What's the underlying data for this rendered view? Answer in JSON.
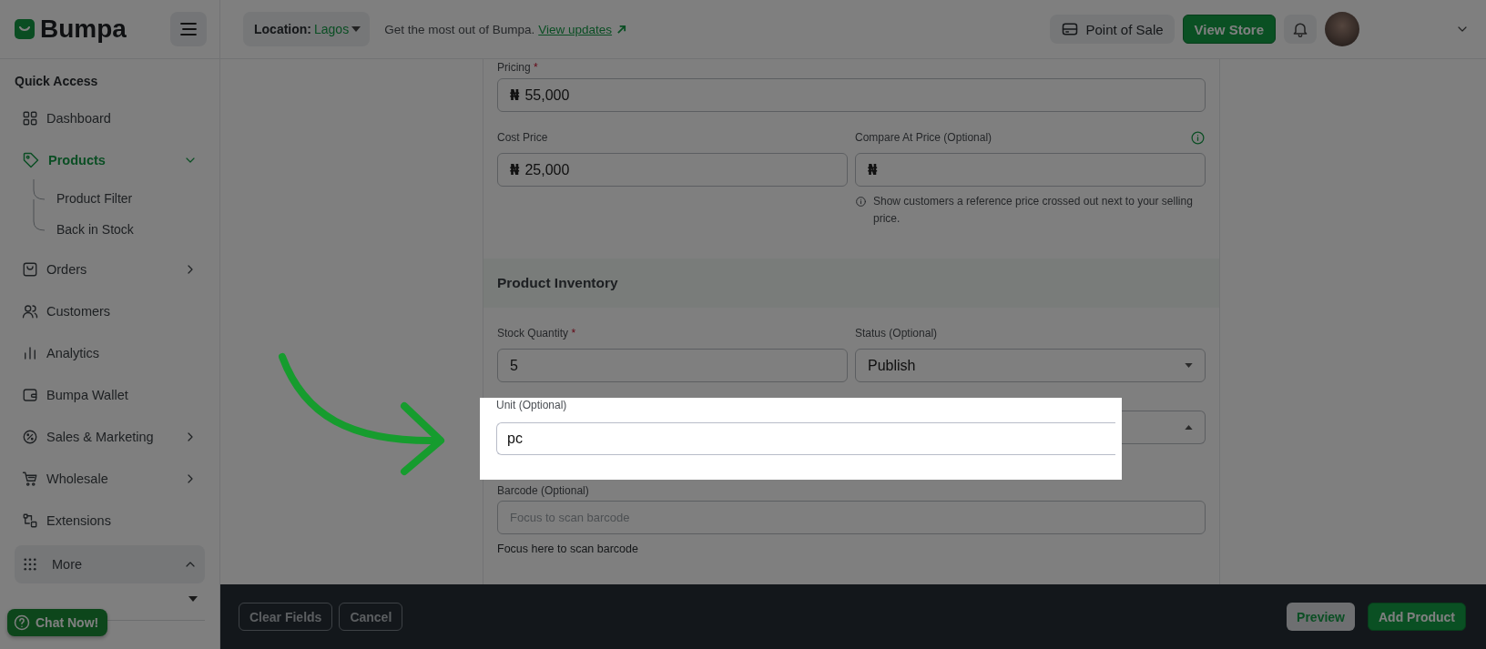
{
  "header": {
    "logo": "Bumpa",
    "location_label": "Location:",
    "location_value": "Lagos",
    "promo_text": "Get the most out of Bumpa.",
    "promo_link": "View updates",
    "pos_button": "Point of Sale",
    "store_button": "View Store"
  },
  "sidebar": {
    "section_title": "Quick Access",
    "items": [
      {
        "label": "Dashboard",
        "kind": "link",
        "selected": false
      },
      {
        "label": "Products",
        "kind": "group",
        "selected": true,
        "expanded": true,
        "children": [
          {
            "label": "Product Filter"
          },
          {
            "label": "Back in Stock"
          }
        ]
      },
      {
        "label": "Orders",
        "kind": "group",
        "selected": false,
        "expanded": false
      },
      {
        "label": "Customers",
        "kind": "link",
        "selected": false
      },
      {
        "label": "Analytics",
        "kind": "link",
        "selected": false
      },
      {
        "label": "Bumpa Wallet",
        "kind": "link",
        "selected": false
      },
      {
        "label": "Sales & Marketing",
        "kind": "group",
        "selected": false,
        "expanded": false
      },
      {
        "label": "Wholesale",
        "kind": "group",
        "selected": false,
        "expanded": false
      },
      {
        "label": "Extensions",
        "kind": "link",
        "selected": false
      },
      {
        "label": "More",
        "kind": "menu",
        "selected": false,
        "expanded": true
      }
    ]
  },
  "chat_button": "Chat Now!",
  "form": {
    "pricing": {
      "label": "Pricing",
      "required_mark": "*",
      "currency": "₦",
      "value": "55,000"
    },
    "cost_price": {
      "label": "Cost Price",
      "currency": "₦",
      "value": "25,000"
    },
    "compare_price": {
      "label": "Compare At Price (Optional)",
      "currency": "₦"
    },
    "compare_hint": "Show customers a reference price crossed out next to your selling price.",
    "inventory_title": "Product Inventory",
    "stock_quantity": {
      "label": "Stock Quantity",
      "required_mark": "*",
      "value": "5"
    },
    "status": {
      "label": "Status (Optional)",
      "value": "Publish"
    },
    "unit": {
      "label": "Unit (Optional)",
      "value": "pc",
      "expanded": true
    },
    "barcode": {
      "label": "Barcode (Optional)",
      "placeholder": "Focus to scan barcode",
      "hint": "Focus here to scan barcode"
    }
  },
  "footer": {
    "buttons": [
      {
        "label": "Clear Fields",
        "kind": "outline"
      },
      {
        "label": "Cancel",
        "kind": "outline"
      },
      {
        "label": "Preview",
        "kind": "light"
      },
      {
        "label": "Add Product",
        "kind": "primary"
      }
    ]
  }
}
